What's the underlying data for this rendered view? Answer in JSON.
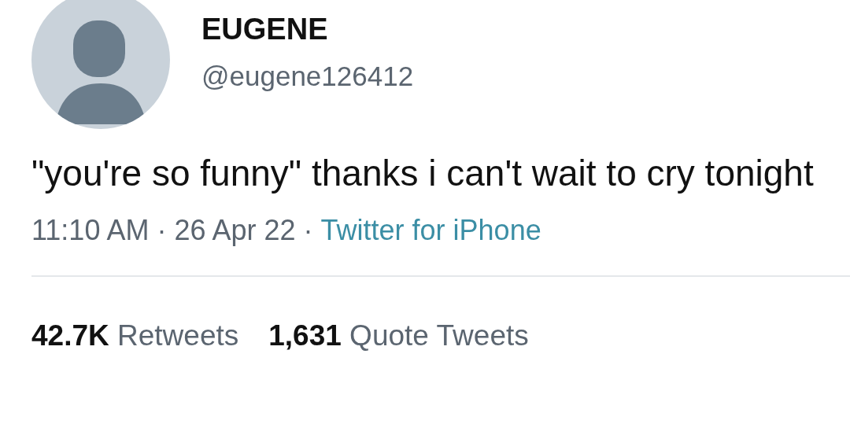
{
  "author": {
    "name": "EUGENE",
    "handle": "@eugene126412"
  },
  "tweet": {
    "text": "\"you're so funny\" thanks i can't wait to cry tonight"
  },
  "meta": [
    {
      "kind": "text",
      "text": "11:10 AM"
    },
    {
      "kind": "separator",
      "text": "·"
    },
    {
      "kind": "text",
      "text": "26 Apr 22"
    },
    {
      "kind": "separator",
      "text": "·"
    },
    {
      "kind": "link",
      "text": "Twitter for iPhone"
    }
  ],
  "stats": [
    {
      "text": "**42.7K** Retweets"
    },
    {
      "text": "**1,631** Quote Tweets"
    }
  ]
}
